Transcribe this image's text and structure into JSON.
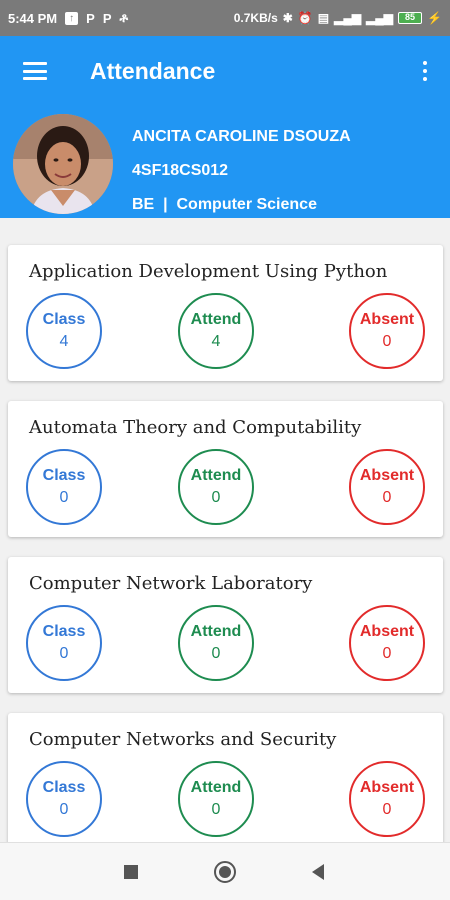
{
  "status_bar": {
    "time": "5:44 PM",
    "speed": "0.7KB/s",
    "battery": "85"
  },
  "appbar": {
    "title": "Attendance"
  },
  "profile": {
    "name": "ANCITA CAROLINE DSOUZA",
    "usn": "4SF18CS012",
    "program": "BE  |  Computer Science"
  },
  "subjects": [
    {
      "name": "Application Development Using Python",
      "class_label": "Class",
      "class": "4",
      "attend_label": "Attend",
      "attend": "4",
      "absent_label": "Absent",
      "absent": "0"
    },
    {
      "name": "Automata Theory and Computability",
      "class_label": "Class",
      "class": "0",
      "attend_label": "Attend",
      "attend": "0",
      "absent_label": "Absent",
      "absent": "0"
    },
    {
      "name": "Computer Network Laboratory",
      "class_label": "Class",
      "class": "0",
      "attend_label": "Attend",
      "attend": "0",
      "absent_label": "Absent",
      "absent": "0"
    },
    {
      "name": "Computer Networks and Security",
      "class_label": "Class",
      "class": "0",
      "attend_label": "Attend",
      "attend": "0",
      "absent_label": "Absent",
      "absent": "0"
    }
  ],
  "colors": {
    "primary": "#2196f3",
    "class": "#3378d6",
    "attend": "#1e8c50",
    "absent": "#e22b2b"
  }
}
